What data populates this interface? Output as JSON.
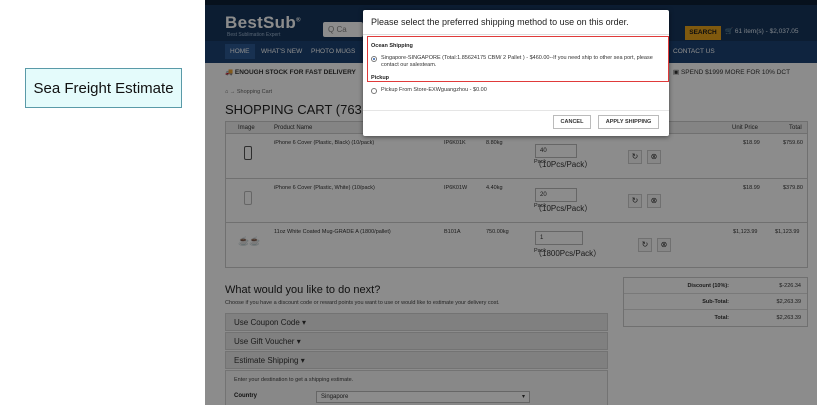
{
  "callout": {
    "label": "Sea Freight Estimate"
  },
  "site": {
    "logo": "BestSub",
    "logo_reg": "®",
    "tagline": "Best Sublimation Expert",
    "search_icon": "Q",
    "search_placeholder": "Ca",
    "search_button": "SEARCH",
    "cart_summary": "61 item(s) - $2,037.05",
    "nav": [
      "HOME",
      "WHAT'S NEW",
      "PHOTO MUGS",
      "CONTACT US"
    ],
    "bar_left": "ENOUGH STOCK FOR FAST DELIVERY",
    "bar_right": "SPEND $1999 MORE FOR 10% DCT"
  },
  "cart": {
    "breadcrumb_home": "⌂",
    "breadcrumb_sep": "→",
    "breadcrumb": "Shopping Cart",
    "title": "SHOPPING CART  (763.",
    "columns": {
      "image": "Image",
      "product": "Product Name",
      "unit_price": "Unit Price",
      "total": "Total"
    },
    "rows": [
      {
        "product": "iPhone 6 Cover (Plastic, Black) (10/pack)",
        "model": "IP6K01K",
        "weight": "8.80kg",
        "qty": "40",
        "pack": "Pack",
        "pack_detail": "（10Pcs/Pack）",
        "unit_price": "$18.99",
        "total": "$759.60"
      },
      {
        "product": "iPhone 6 Cover (Plastic, White) (10/pack)",
        "model": "IP6K01W",
        "weight": "4.40kg",
        "qty": "20",
        "pack": "Pack",
        "pack_detail": "（10Pcs/Pack）",
        "unit_price": "$18.99",
        "total": "$379.80"
      },
      {
        "product": "11oz White Coated Mug-GRADE A (1800/pallet)",
        "model": "B101A",
        "weight": "750.00kg",
        "qty": "1",
        "pack": "Pack",
        "pack_detail": "（1800Pcs/Pack）",
        "unit_price": "$1,123.99",
        "total": "$1,123.99"
      }
    ]
  },
  "next": {
    "title": "What would you like to do next?",
    "subtitle": "Choose if you have a discount code or reward points you want to use or would like to estimate your delivery cost.",
    "coupon": "Use Coupon Code ▾",
    "voucher": "Use Gift Voucher ▾",
    "shipping": "Estimate Shipping ▾",
    "dest_text": "Enter your destination to get a shipping estimate.",
    "country_label": "Country",
    "country_value": "Singapore"
  },
  "totals": [
    {
      "label": "Discount (10%):",
      "value": "$-226.34"
    },
    {
      "label": "Sub-Total:",
      "value": "$2,263.39"
    },
    {
      "label": "Total:",
      "value": "$2,263.39"
    }
  ],
  "modal": {
    "title": "Please select the preferred shipping method to use on this order.",
    "group1": "Ocean Shipping",
    "opt1": "Singapore-SINGAPORE (Total:1.85624175 CBM/ 2 Pallet ) - $460.00--If you need ship to other sea port, please contact our salesteam.",
    "group2": "Pickup",
    "opt2": "Pickup From Store-EXWguangzhou - $0.00",
    "cancel": "CANCEL",
    "apply": "APPLY SHIPPING"
  }
}
